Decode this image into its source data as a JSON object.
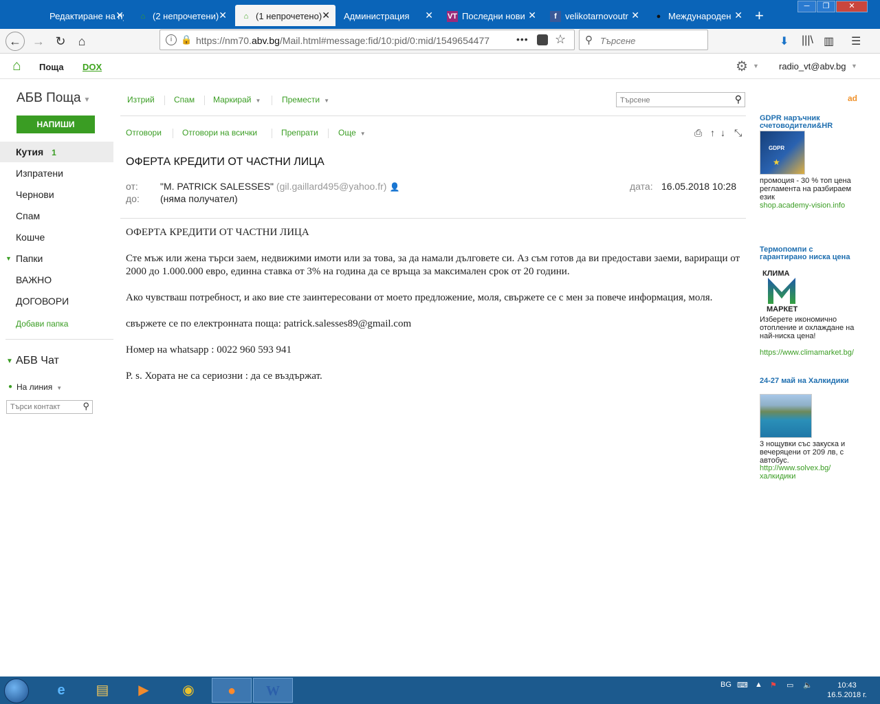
{
  "browser": {
    "tabs": [
      {
        "label": "Редактиране на пуб",
        "icon": "doc"
      },
      {
        "label": "(2 непрочетени)",
        "icon": "abv"
      },
      {
        "label": "(1 непрочетено)",
        "icon": "abv"
      },
      {
        "label": "Администрация",
        "icon": "none"
      },
      {
        "label": "Последни нови",
        "icon": "VT"
      },
      {
        "label": "velikotarnovoutr",
        "icon": "f"
      },
      {
        "label": "Международен",
        "icon": "dark"
      }
    ],
    "url_prefix": "https://nm70.",
    "url_host": "abv.bg",
    "url_rest": "/Mail.html#message:fid/10:pid/0:mid/1549654477",
    "search_placeholder": "Търсене"
  },
  "app": {
    "poshta": "Поща",
    "dox": "DOX",
    "user": "radio_vt@abv.bg",
    "logo": "АБВ Поща",
    "write": "НАПИШИ",
    "folders": [
      {
        "label": "Кутия",
        "count": "1"
      },
      {
        "label": "Изпратени"
      },
      {
        "label": "Чернови"
      },
      {
        "label": "Спам"
      },
      {
        "label": "Кошче"
      },
      {
        "label": "Папки"
      },
      {
        "label": "ВАЖНО"
      },
      {
        "label": "ДОГОВОРИ"
      }
    ],
    "add_folder": "Добави папка",
    "chat": "АБВ Чат",
    "online": "На линия",
    "contact_search": "Търси контакт"
  },
  "toolbar": {
    "delete": "Изтрий",
    "spam": "Спам",
    "mark": "Маркирай",
    "move": "Премести",
    "search": "Търсене"
  },
  "actions": {
    "reply": "Отговори",
    "reply_all": "Отговори на всички",
    "forward": "Препрати",
    "more": "Още"
  },
  "message": {
    "subject": "ОФЕРТА КРЕДИТИ ОТ ЧАСТНИ ЛИЦА",
    "from_label": "от:",
    "from_name": "\"M. PATRICK SALESSES\"",
    "from_email": "(gil.gaillard495@yahoo.fr)",
    "to_label": "до:",
    "to": "(няма получател)",
    "date_label": "дата:",
    "date": "16.05.2018 10:28",
    "body": [
      "ОФЕРТА КРЕДИТИ ОТ ЧАСТНИ ЛИЦА",
      "Сте мъж или жена търси заем, недвижими имоти или за това, за да намали дълговете си. Аз съм готов да ви предостави заеми, вариращи от 2000 до 1.000.000 евро, единна ставка от 3% на година да се връща за максимален срок от 20 години.",
      "Ако чувстваш потребност, и ако вие сте заинтересовани от моето предложение, моля, свържете се с мен за повече информация, моля.",
      "свържете се по електронната поща: patrick.salesses89@gmail.com",
      "Номер на whatsapp : 0022 960 593 941",
      "P. s. Хората не са сериозни : да се въздържат."
    ]
  },
  "ads": {
    "ad_mark": "ad",
    "items": [
      {
        "title": "GDPR наръчник счетоводители&HR",
        "text": "промоция - 30 % топ цена регламента на разбираем език",
        "link": "shop.academy-vision.info"
      },
      {
        "title": "Термопомпи с гарантирано ниска цена",
        "brand1": "КЛИМА",
        "brand2": "МАРКЕТ",
        "text": "Изберете икономично отопление и охлаждане на най-ниска цена!",
        "link": "https://www.climamarket.bg/"
      },
      {
        "title": "24-27 май на Халкидики",
        "text": "3 нощувки със закуска и вечеряцени от 209 лв, с автобус.",
        "link": "http://www.solvex.bg/халкидики"
      }
    ]
  },
  "taskbar": {
    "lang": "BG",
    "time": "10:43",
    "date": "16.5.2018 г."
  }
}
